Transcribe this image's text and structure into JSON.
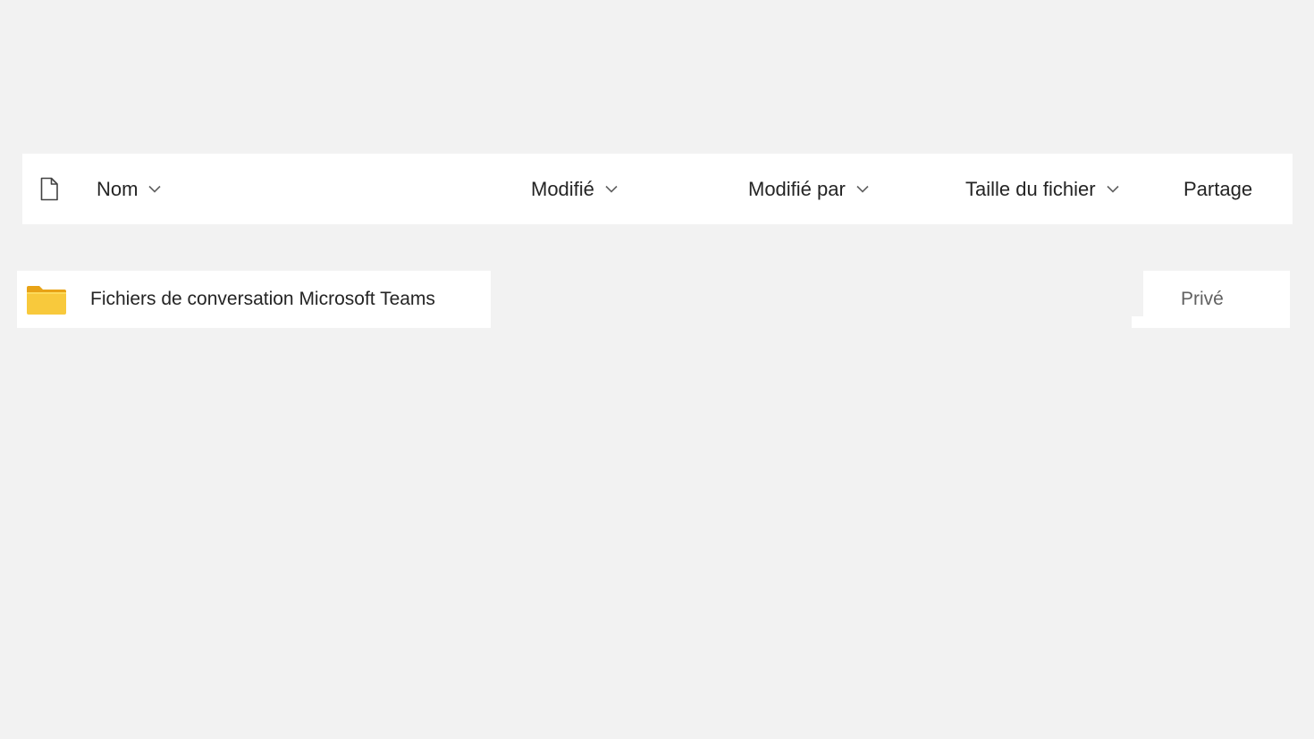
{
  "header": {
    "columns": {
      "name": "Nom",
      "modified": "Modifié",
      "modified_by": "Modifié par",
      "file_size": "Taille du fichier",
      "sharing": "Partage"
    }
  },
  "rows": [
    {
      "name": "Fichiers de conversation Microsoft Teams",
      "type": "folder-icon",
      "sharing": "Privé"
    }
  ],
  "colors": {
    "background": "#f2f2f2",
    "surface": "#ffffff",
    "text": "#242424",
    "muted_text": "#616161",
    "folder": "#f8c93c"
  }
}
